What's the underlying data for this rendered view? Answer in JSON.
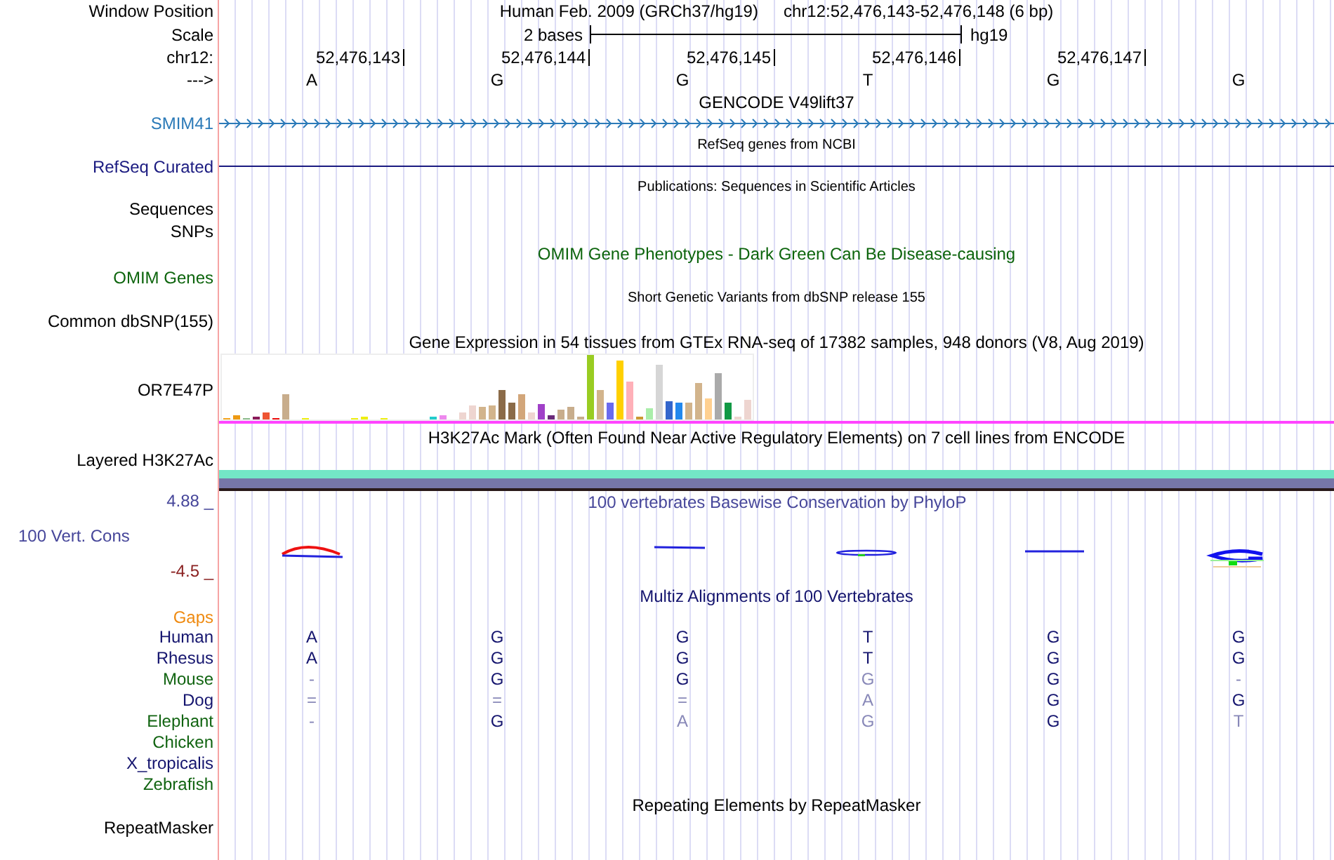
{
  "header": {
    "label": "Window Position",
    "assembly": "Human Feb. 2009 (GRCh37/hg19)",
    "position": "chr12:52,476,143-52,476,148 (6 bp)"
  },
  "scale": {
    "label": "Scale",
    "length": "2 bases",
    "database": "hg19"
  },
  "ruler": {
    "label": "chr12:",
    "ticks": [
      "52,476,143",
      "52,476,144",
      "52,476,145",
      "52,476,146",
      "52,476,147"
    ]
  },
  "sequence": {
    "label": "--->",
    "bases": [
      "A",
      "G",
      "G",
      "T",
      "G",
      "G"
    ]
  },
  "tracks": [
    {
      "kind": "gene",
      "title": "GENCODE V49lift37",
      "label": "SMIM41",
      "color": "#2b7ab8"
    },
    {
      "kind": "line",
      "title": "RefSeq genes from NCBI",
      "label": "RefSeq Curated",
      "color": "#1a1a80"
    },
    {
      "kind": "publications",
      "title": "Publications: Sequences in Scientific Articles",
      "labels": [
        "Sequences",
        "SNPs"
      ],
      "color": "#000000"
    },
    {
      "kind": "phenotype",
      "title": "OMIM Gene Phenotypes - Dark Green Can Be Disease-causing",
      "label": "OMIM Genes",
      "color": "#0c640c"
    },
    {
      "kind": "variants",
      "title": "Short Genetic Variants from dbSNP release 155",
      "label": "Common dbSNP(155)",
      "color": "#000000"
    },
    {
      "kind": "expression",
      "title": "Gene Expression in 54 tissues from GTEx RNA-seq of 17382 samples, 948 donors (V8, Aug 2019)",
      "label": "OR7E47P",
      "color": "#000000"
    },
    {
      "kind": "layered",
      "title": "H3K27Ac Mark (Often Found Near Active Regulatory Elements) on 7 cell lines from ENCODE",
      "label": "Layered H3K27Ac",
      "color": "#000000"
    },
    {
      "kind": "conservation",
      "title": "100 vertebrates Basewise Conservation by PhyloP",
      "label": "100 Vert. Cons",
      "max": "4.88 _",
      "min": "-4.5 _",
      "color": "#46469a"
    },
    {
      "kind": "alignment",
      "title": "Multiz Alignments of 100 Vertebrates",
      "color": "#14146e",
      "rows": [
        {
          "kind": "gaps",
          "name": "Gaps",
          "color": "#ef8a10"
        },
        {
          "kind": "species",
          "name": "Human",
          "color": "#14146e",
          "bases": [
            {
              "b": "A",
              "match": true
            },
            {
              "b": "G",
              "match": true
            },
            {
              "b": "G",
              "match": true
            },
            {
              "b": "T",
              "match": true
            },
            {
              "b": "G",
              "match": true
            },
            {
              "b": "G",
              "match": true
            }
          ]
        },
        {
          "kind": "species",
          "name": "Rhesus",
          "color": "#14146e",
          "bases": [
            {
              "b": "A",
              "match": true
            },
            {
              "b": "G",
              "match": true
            },
            {
              "b": "G",
              "match": true
            },
            {
              "b": "T",
              "match": true
            },
            {
              "b": "G",
              "match": true
            },
            {
              "b": "G",
              "match": true
            }
          ]
        },
        {
          "kind": "species",
          "name": "Mouse",
          "color": "#116411",
          "bases": [
            {
              "b": "-",
              "match": false
            },
            {
              "b": "G",
              "match": true
            },
            {
              "b": "G",
              "match": true
            },
            {
              "b": "G",
              "match": false
            },
            {
              "b": "G",
              "match": true
            },
            {
              "b": "-",
              "match": false
            }
          ]
        },
        {
          "kind": "species",
          "name": "Dog",
          "color": "#14146e",
          "bases": [
            {
              "b": "=",
              "match": false
            },
            {
              "b": "=",
              "match": false
            },
            {
              "b": "=",
              "match": false
            },
            {
              "b": "A",
              "match": false
            },
            {
              "b": "G",
              "match": true
            },
            {
              "b": "G",
              "match": true
            }
          ]
        },
        {
          "kind": "species",
          "name": "Elephant",
          "color": "#116411",
          "bases": [
            {
              "b": "-",
              "match": false
            },
            {
              "b": "G",
              "match": true
            },
            {
              "b": "A",
              "match": false
            },
            {
              "b": "G",
              "match": false
            },
            {
              "b": "G",
              "match": true
            },
            {
              "b": "T",
              "match": false
            }
          ]
        },
        {
          "kind": "species",
          "name": "Chicken",
          "color": "#116411"
        },
        {
          "kind": "species",
          "name": "X_tropicalis",
          "color": "#14146e"
        },
        {
          "kind": "species",
          "name": "Zebrafish",
          "color": "#116411"
        }
      ]
    },
    {
      "kind": "repeats",
      "title": "Repeating Elements by RepeatMasker",
      "label": "RepeatMasker",
      "color": "#000000"
    }
  ]
}
